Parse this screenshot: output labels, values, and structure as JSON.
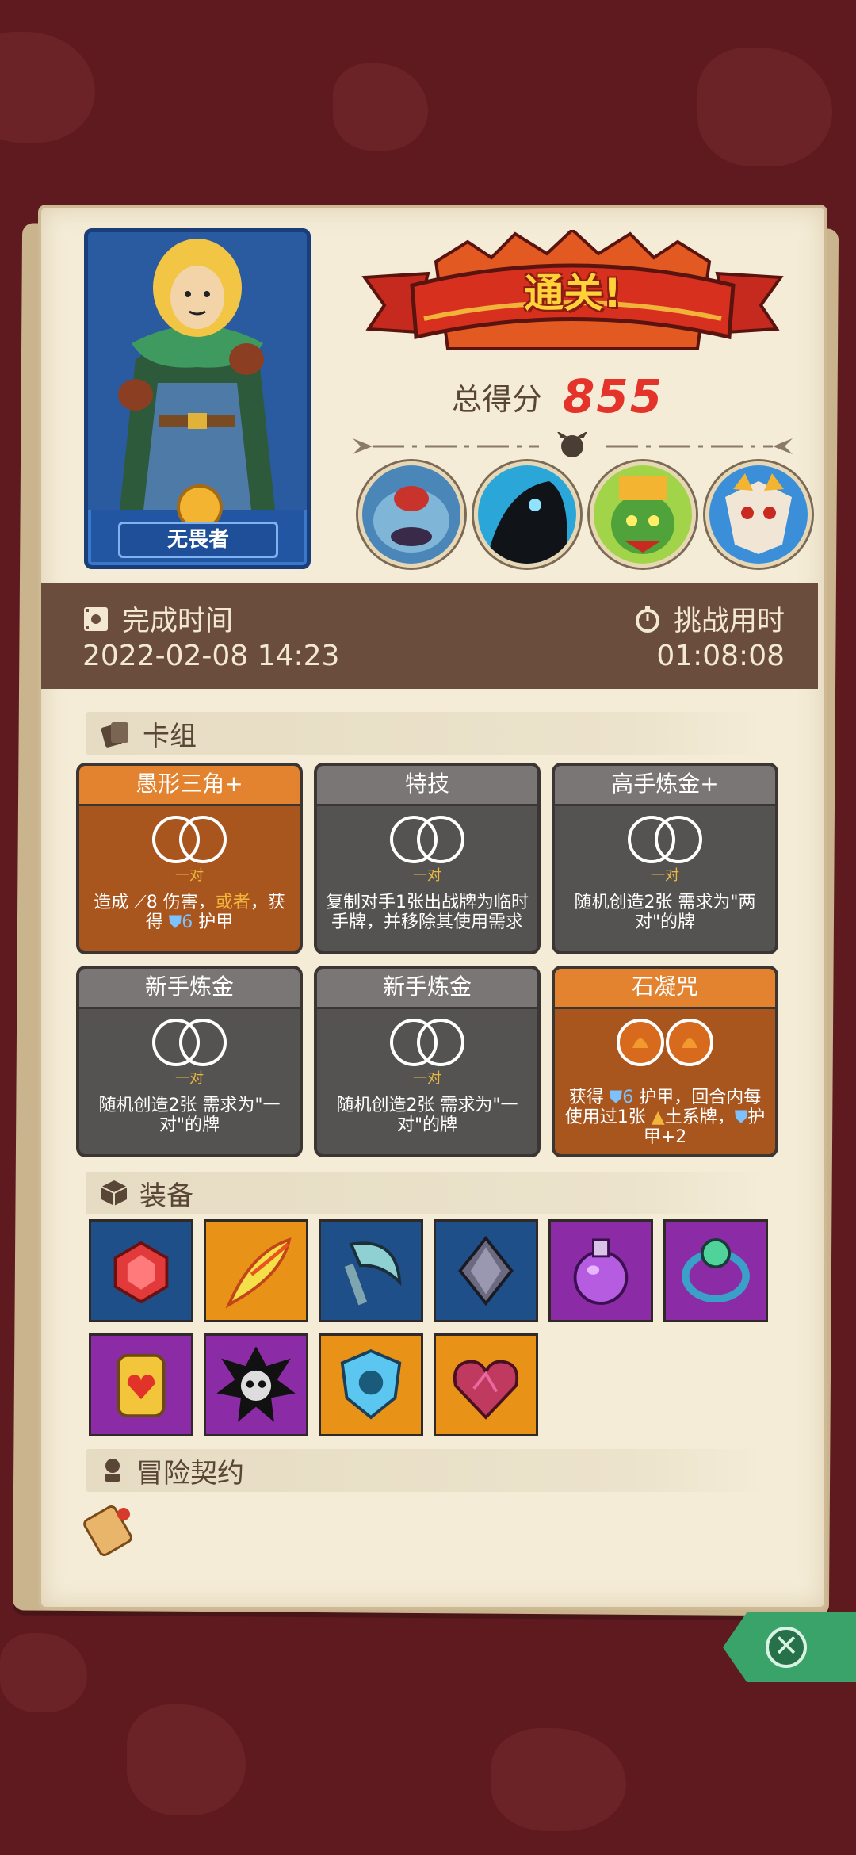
{
  "hero": {
    "name": "无畏者"
  },
  "result": {
    "banner": "通关!",
    "score_label": "总得分",
    "score_value": "855"
  },
  "bosses": [
    {
      "icon": "blue-toad-boss-icon"
    },
    {
      "icon": "shadow-beast-boss-icon"
    },
    {
      "icon": "green-goblin-king-boss-icon"
    },
    {
      "icon": "demon-mask-boss-icon"
    }
  ],
  "time": {
    "finish_label": "完成时间",
    "finish_value": "2022-02-08 14:23",
    "challenge_label": "挑战用时",
    "challenge_value": "01:08:08"
  },
  "deck": {
    "title": "卡组",
    "cards": [
      {
        "name": "愚形三角+",
        "dice": "一对",
        "desc_a": "造成 ",
        "desc_b": "8 伤害，",
        "desc_c": "或者",
        "desc_d": "，获得 ",
        "desc_e": "6",
        "desc_f": " 护甲"
      },
      {
        "name": "特技",
        "dice": "一对",
        "desc": "复制对手1张出战牌为临时手牌，并移除其使用需求"
      },
      {
        "name": "高手炼金+",
        "dice": "一对",
        "desc": "随机创造2张 需求为\"两对\"的牌"
      },
      {
        "name": "新手炼金",
        "dice": "一对",
        "desc": "随机创造2张 需求为\"一对\"的牌"
      },
      {
        "name": "新手炼金",
        "dice": "一对",
        "desc": "随机创造2张 需求为\"一对\"的牌"
      },
      {
        "name": "石凝咒",
        "desc_a": "获得 ",
        "desc_b": "6",
        "desc_c": " 护甲，回合内每使用过1张 ",
        "desc_d": "土系牌，",
        "desc_e": "护甲+2"
      }
    ]
  },
  "equipment": {
    "title": "装备",
    "items": [
      {
        "icon": "red-gem-icon"
      },
      {
        "icon": "phoenix-feather-icon"
      },
      {
        "icon": "axe-blade-icon"
      },
      {
        "icon": "dark-crystal-icon"
      },
      {
        "icon": "purple-potion-icon"
      },
      {
        "icon": "magic-ring-icon"
      },
      {
        "icon": "heart-tablet-icon"
      },
      {
        "icon": "skull-burst-icon"
      },
      {
        "icon": "skull-shield-icon"
      },
      {
        "icon": "heart-gem-icon"
      }
    ]
  },
  "contract": {
    "title": "冒险契约"
  },
  "colors": {
    "background": "#5e1a1e",
    "parchment": "#f4ecd7",
    "accent_red": "#e4332b",
    "band": "#6b4d3e"
  }
}
